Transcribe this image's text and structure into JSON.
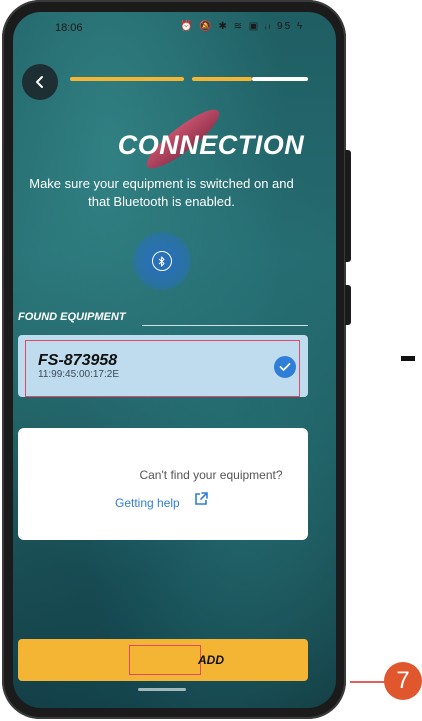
{
  "status_bar": {
    "time": "18:06",
    "icons": "⏰ 🔕 ✱ ≋ ▣ ᵢₗ 95 ϟ"
  },
  "header": {
    "title": "CONNECTION",
    "subtitle": "Make sure your equipment is switched on and that Bluetooth is enabled."
  },
  "progress": {
    "steps_complete": 1.5,
    "steps_total": 2
  },
  "found": {
    "label": "FOUND EQUIPMENT",
    "devices": [
      {
        "name": "FS-873958",
        "mac": "11:99:45:00:17:2E",
        "selected": true
      }
    ]
  },
  "help": {
    "question": "Can't find your equipment?",
    "link": "Getting help"
  },
  "footer": {
    "add_label": "ADD"
  },
  "annotation": {
    "step": "7"
  },
  "colors": {
    "accent_yellow": "#f3b533",
    "selection_blue": "#2f7fd8",
    "highlight_red": "#e04a6a",
    "badge": "#e0572d"
  },
  "icons": [
    "chevron-left-icon",
    "bluetooth-icon",
    "check-circle-icon",
    "external-link-icon"
  ]
}
